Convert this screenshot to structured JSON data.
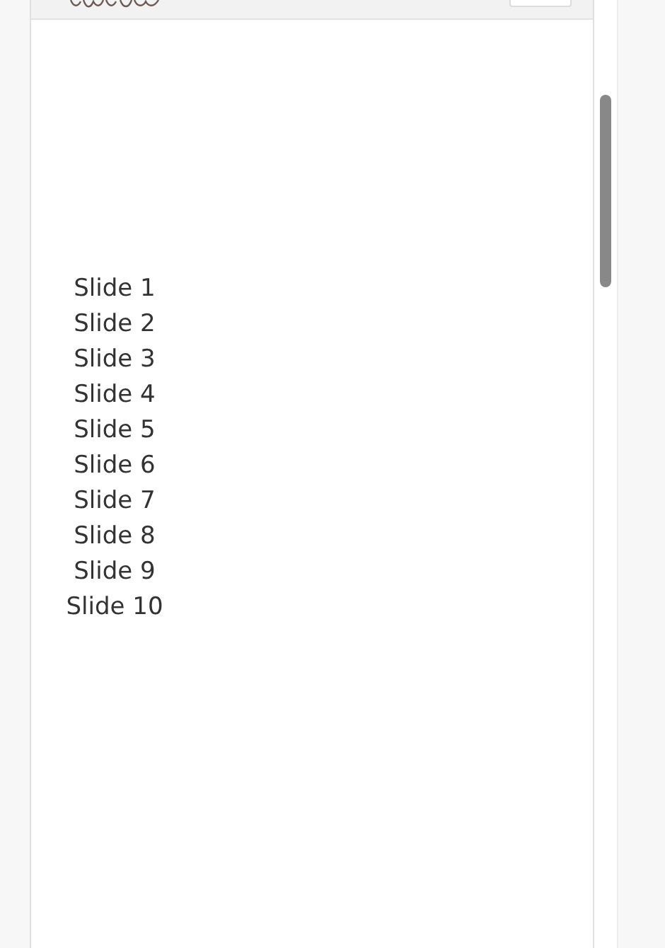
{
  "slides": [
    "Slide 1",
    "Slide 2",
    "Slide 3",
    "Slide 4",
    "Slide 5",
    "Slide 6",
    "Slide 7",
    "Slide 8",
    "Slide 9",
    "Slide 10"
  ]
}
